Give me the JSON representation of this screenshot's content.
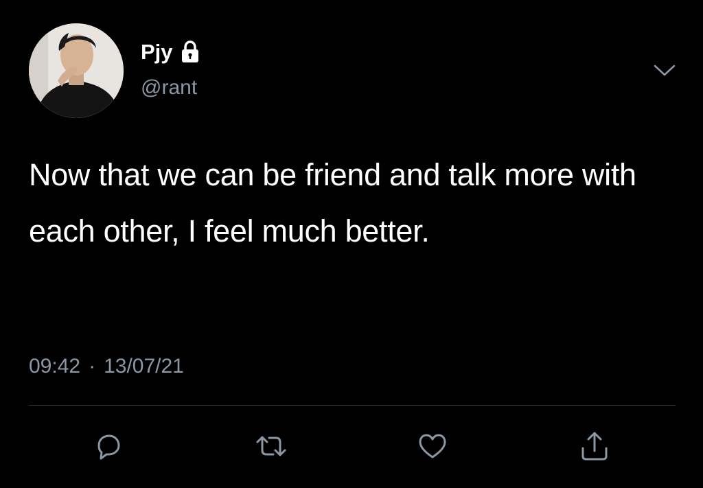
{
  "tweet": {
    "author": {
      "display_name": "Pjy",
      "handle": "@rant",
      "protected_icon": "lock-icon",
      "avatar_icon": "avatar-photo"
    },
    "text": "Now that we can be friend and talk more with each other, I feel much better.",
    "time": "09:42",
    "separator": "·",
    "date": "13/07/21",
    "menu_icon": "chevron-down-icon"
  },
  "actions": [
    {
      "name": "reply",
      "icon": "reply-icon"
    },
    {
      "name": "retweet",
      "icon": "retweet-icon"
    },
    {
      "name": "like",
      "icon": "heart-icon"
    },
    {
      "name": "share",
      "icon": "share-icon"
    }
  ],
  "colors": {
    "background": "#000000",
    "primary_text": "#ffffff",
    "secondary_text": "#8b98a5",
    "divider": "#2f3336",
    "icon": "#8b98a5"
  }
}
